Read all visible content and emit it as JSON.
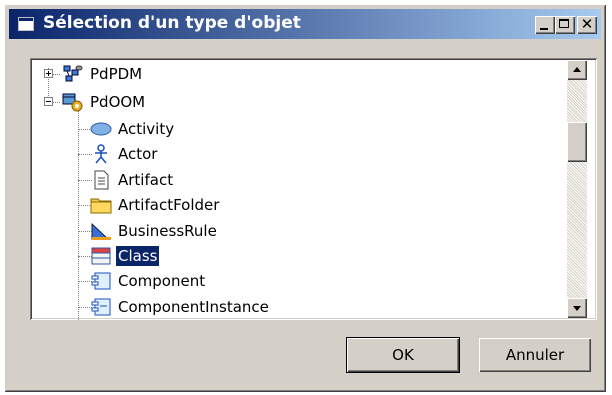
{
  "window": {
    "title": "Sélection d'un type d'objet"
  },
  "tree": {
    "nodes": [
      {
        "label": "PdPDM",
        "icon": "pdm-model-icon",
        "expander": "plus"
      },
      {
        "label": "PdOOM",
        "icon": "oom-model-icon",
        "expander": "minus"
      },
      {
        "label": "Activity",
        "icon": "activity-icon"
      },
      {
        "label": "Actor",
        "icon": "actor-icon"
      },
      {
        "label": "Artifact",
        "icon": "artifact-icon"
      },
      {
        "label": "ArtifactFolder",
        "icon": "folder-icon"
      },
      {
        "label": "BusinessRule",
        "icon": "business-rule-icon"
      },
      {
        "label": "Class",
        "icon": "class-icon",
        "selected": true
      },
      {
        "label": "Component",
        "icon": "component-icon"
      },
      {
        "label": "ComponentInstance",
        "icon": "component-instance-icon"
      }
    ]
  },
  "buttons": {
    "ok": "OK",
    "cancel": "Annuler"
  },
  "colors": {
    "selection": "#0a246a",
    "titlebar_start": "#0a246a",
    "titlebar_end": "#a6caf0"
  }
}
